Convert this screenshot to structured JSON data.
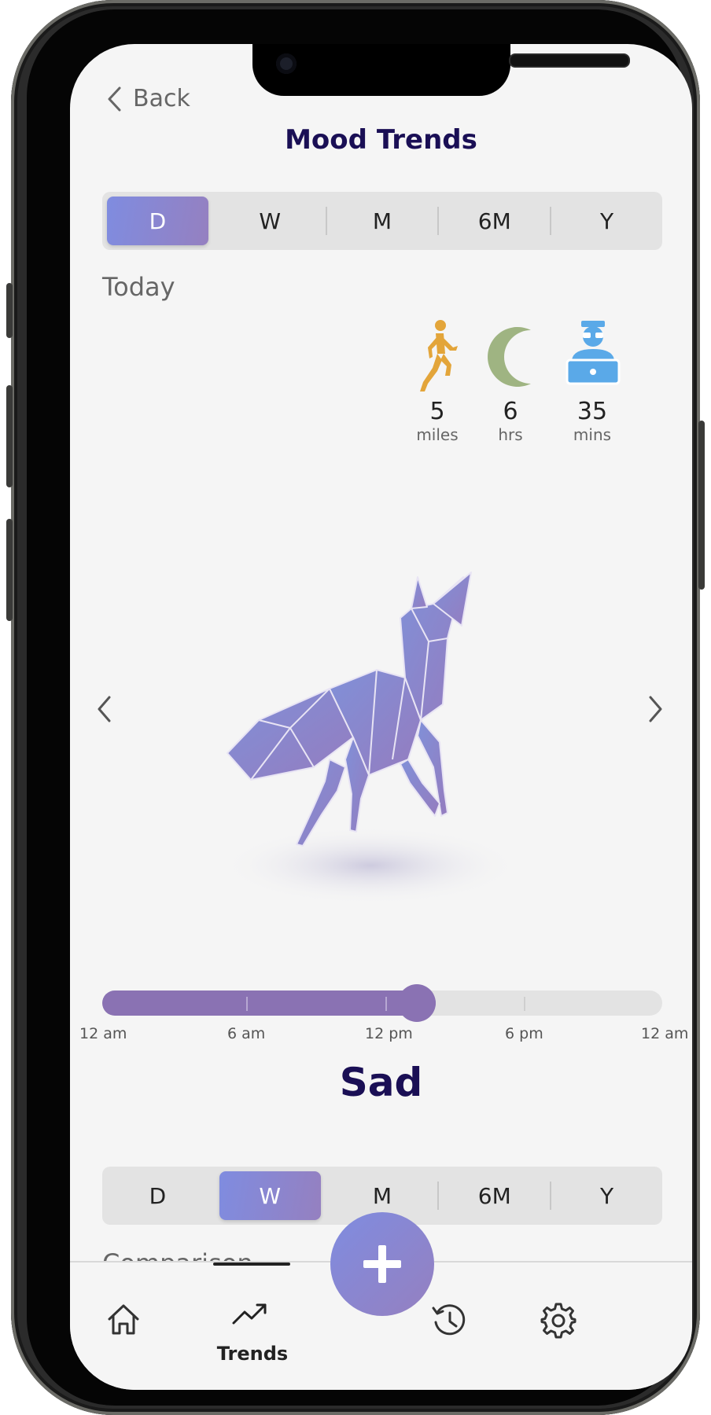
{
  "nav": {
    "back_label": "Back",
    "title": "Mood Trends"
  },
  "period_selector": {
    "options": [
      "D",
      "W",
      "M",
      "6M",
      "Y"
    ],
    "selected": "D"
  },
  "today_label": "Today",
  "stats": [
    {
      "icon": "running-person-icon",
      "value": "5",
      "unit": "miles",
      "color": "#e3a53a"
    },
    {
      "icon": "moon-icon",
      "value": "6",
      "unit": "hrs",
      "color": "#9fb482"
    },
    {
      "icon": "person-laptop-icon",
      "value": "35",
      "unit": "mins",
      "color": "#5aa9e8"
    }
  ],
  "mood_image": {
    "icon": "origami-fox-illustration",
    "color": "#8a80c8"
  },
  "time_slider": {
    "labels": [
      "12 am",
      "6 am",
      "12 pm",
      "6 pm",
      "12 am"
    ],
    "progress": 0.595,
    "fill_color": "#8a72b3"
  },
  "mood_label": "Sad",
  "comparison_selector": {
    "options": [
      "D",
      "W",
      "M",
      "6M",
      "Y"
    ],
    "selected": "W"
  },
  "comparison_label": "Comparison",
  "tabbar": {
    "items": [
      {
        "icon": "home-icon"
      },
      {
        "icon": "trends-icon",
        "label": "Trends",
        "active": true
      },
      {
        "icon": "history-icon"
      },
      {
        "icon": "gear-icon"
      }
    ],
    "fab_icon": "plus-icon",
    "accent": "#8a80c8"
  }
}
